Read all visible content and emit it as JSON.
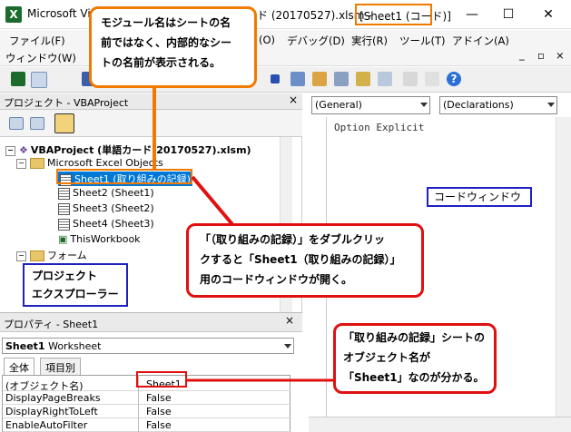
{
  "titlebar": {
    "app_title": "Microsoft Vis",
    "title_middle": "ド (20170527).xlsm -",
    "title_sheet": "[Sheet1 (コード)]",
    "minimize": "—",
    "maximize": "☐",
    "close": "✕"
  },
  "menu": {
    "row1": [
      "ファイル(F)",
      "(O)",
      "デバッグ(D)",
      "実行(R)",
      "ツール(T)",
      "アドイン(A)"
    ],
    "row2": [
      "ウィンドウ(W)"
    ],
    "row2_right": [
      "_",
      "▫",
      "×"
    ]
  },
  "project": {
    "title": "プロジェクト - VBAProject",
    "close": "×",
    "root": "VBAProject (単語カード(20170527).xlsm)",
    "folder_excel": "Microsoft Excel Objects",
    "sheets": [
      "Sheet1 (取り組みの記録)",
      "Sheet2 (Sheet1)",
      "Sheet3 (Sheet2)",
      "Sheet4 (Sheet3)"
    ],
    "workbook": "ThisWorkbook",
    "folder_forms": "フォーム"
  },
  "properties": {
    "title": "プロパティ - Sheet1",
    "close": "×",
    "combo_name": "Sheet1",
    "combo_type": "Worksheet",
    "tabs": [
      "全体",
      "項目別"
    ],
    "rows": [
      {
        "name": "(オブジェクト名)",
        "value": "Sheet1"
      },
      {
        "name": "DisplayPageBreaks",
        "value": "False"
      },
      {
        "name": "DisplayRightToLeft",
        "value": "False"
      },
      {
        "name": "EnableAutoFilter",
        "value": "False"
      }
    ]
  },
  "code": {
    "combo_left": "(General)",
    "combo_right": "(Declarations)",
    "line1": "Option Explicit"
  },
  "annotations": {
    "orange": [
      "モジュール名はシートの名",
      "前ではなく、内部的なシー",
      "トの名前が表示される。"
    ],
    "red": [
      "「（取り組みの記録）」をダブルクリッ",
      "クすると「Sheet1（取り組みの記録）」",
      "用のコードウィンドウが開く。"
    ],
    "red2": [
      "「取り組みの記録」シートの",
      "オブジェクト名が",
      "「Sheet1」なのが分かる。"
    ],
    "code_window_label": "コードウィンドウ",
    "project_explorer_label": [
      "プロジェクト",
      "エクスプローラー"
    ]
  },
  "colors": {
    "orange": "#f07a00",
    "red": "#e01010",
    "blue": "#2020c0",
    "selection": "#0078d7"
  }
}
